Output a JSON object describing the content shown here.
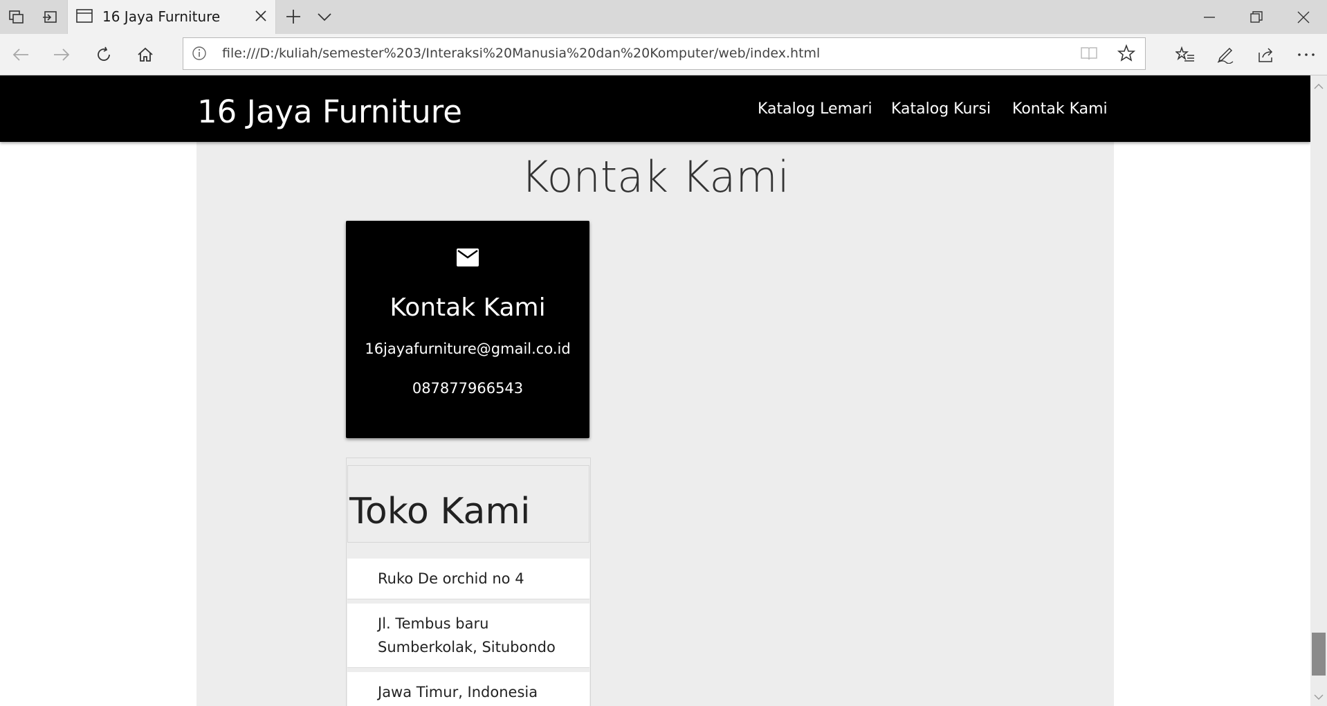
{
  "browser": {
    "tab_title": "16 Jaya Furniture",
    "url": "file:///D:/kuliah/semester%203/Interaksi%20Manusia%20dan%20Komputer/web/index.html"
  },
  "site": {
    "brand": "16 Jaya Furniture",
    "nav": [
      "Katalog Lemari",
      "Katalog Kursi",
      "Kontak Kami"
    ]
  },
  "page": {
    "title": "Kontak Kami",
    "contact_card": {
      "icon": "mail-icon",
      "title": "Kontak Kami",
      "email": "16jayafurniture@gmail.co.id",
      "phone": "087877966543"
    },
    "store": {
      "title": "Toko Kami",
      "address": [
        "Ruko De orchid no 4",
        "Jl. Tembus baru Sumberkolak, Situbondo",
        "Jawa Timur, Indonesia"
      ]
    }
  }
}
